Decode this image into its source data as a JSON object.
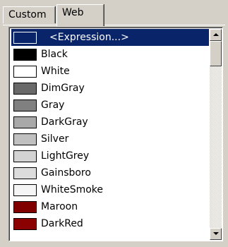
{
  "tabs": [
    {
      "label": "Custom",
      "active": false
    },
    {
      "label": "Web",
      "active": true
    }
  ],
  "colors": {
    "window_bg": "#d4d0c8",
    "selection_bg": "#0a246a"
  },
  "list": {
    "items": [
      {
        "label": "<Expression...>",
        "color": "#0a246a",
        "selected": true
      },
      {
        "label": "Black",
        "color": "#000000"
      },
      {
        "label": "White",
        "color": "#ffffff"
      },
      {
        "label": "DimGray",
        "color": "#696969"
      },
      {
        "label": "Gray",
        "color": "#808080"
      },
      {
        "label": "DarkGray",
        "color": "#a9a9a9"
      },
      {
        "label": "Silver",
        "color": "#c0c0c0"
      },
      {
        "label": "LightGrey",
        "color": "#d3d3d3"
      },
      {
        "label": "Gainsboro",
        "color": "#dcdcdc"
      },
      {
        "label": "WhiteSmoke",
        "color": "#f5f5f5"
      },
      {
        "label": "Maroon",
        "color": "#800000"
      },
      {
        "label": "DarkRed",
        "color": "#8b0000"
      }
    ]
  },
  "scrollbar": {
    "up_icon": "scroll-up-arrow-icon",
    "down_icon": "scroll-down-arrow-icon"
  }
}
